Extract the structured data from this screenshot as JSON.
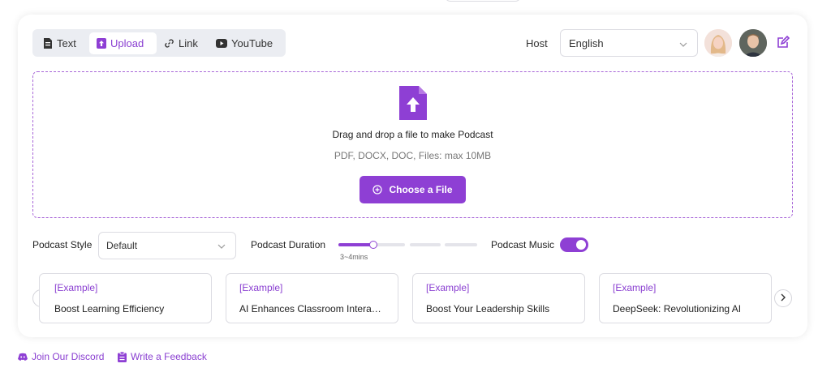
{
  "tabs": [
    {
      "label": "Text",
      "icon": "document-icon"
    },
    {
      "label": "Upload",
      "icon": "upload-icon",
      "active": true
    },
    {
      "label": "Link",
      "icon": "link-icon"
    },
    {
      "label": "YouTube",
      "icon": "youtube-icon"
    }
  ],
  "host": {
    "label": "Host",
    "language": "English"
  },
  "upload": {
    "title": "Drag and drop a file to make Podcast",
    "subtitle": "PDF, DOCX, DOC, Files: max 10MB",
    "button_label": "Choose a File"
  },
  "settings": {
    "style_label": "Podcast Style",
    "style_value": "Default",
    "duration_label": "Podcast Duration",
    "duration_value": "3~4mins",
    "duration_level": 0.26,
    "music_label": "Podcast Music",
    "music_on": true
  },
  "examples": [
    {
      "tag": "[Example]",
      "title": "Boost Learning Efficiency"
    },
    {
      "tag": "[Example]",
      "title": "AI Enhances Classroom Interaction"
    },
    {
      "tag": "[Example]",
      "title": "Boost Your Leadership Skills"
    },
    {
      "tag": "[Example]",
      "title": "DeepSeek: Revolutionizing AI"
    }
  ],
  "footer": {
    "discord": "Join Our Discord",
    "feedback": "Write a Feedback"
  },
  "colors": {
    "accent": "#8e3fd4",
    "border": "#dcdce2",
    "tab_bg": "#ebedf2"
  }
}
